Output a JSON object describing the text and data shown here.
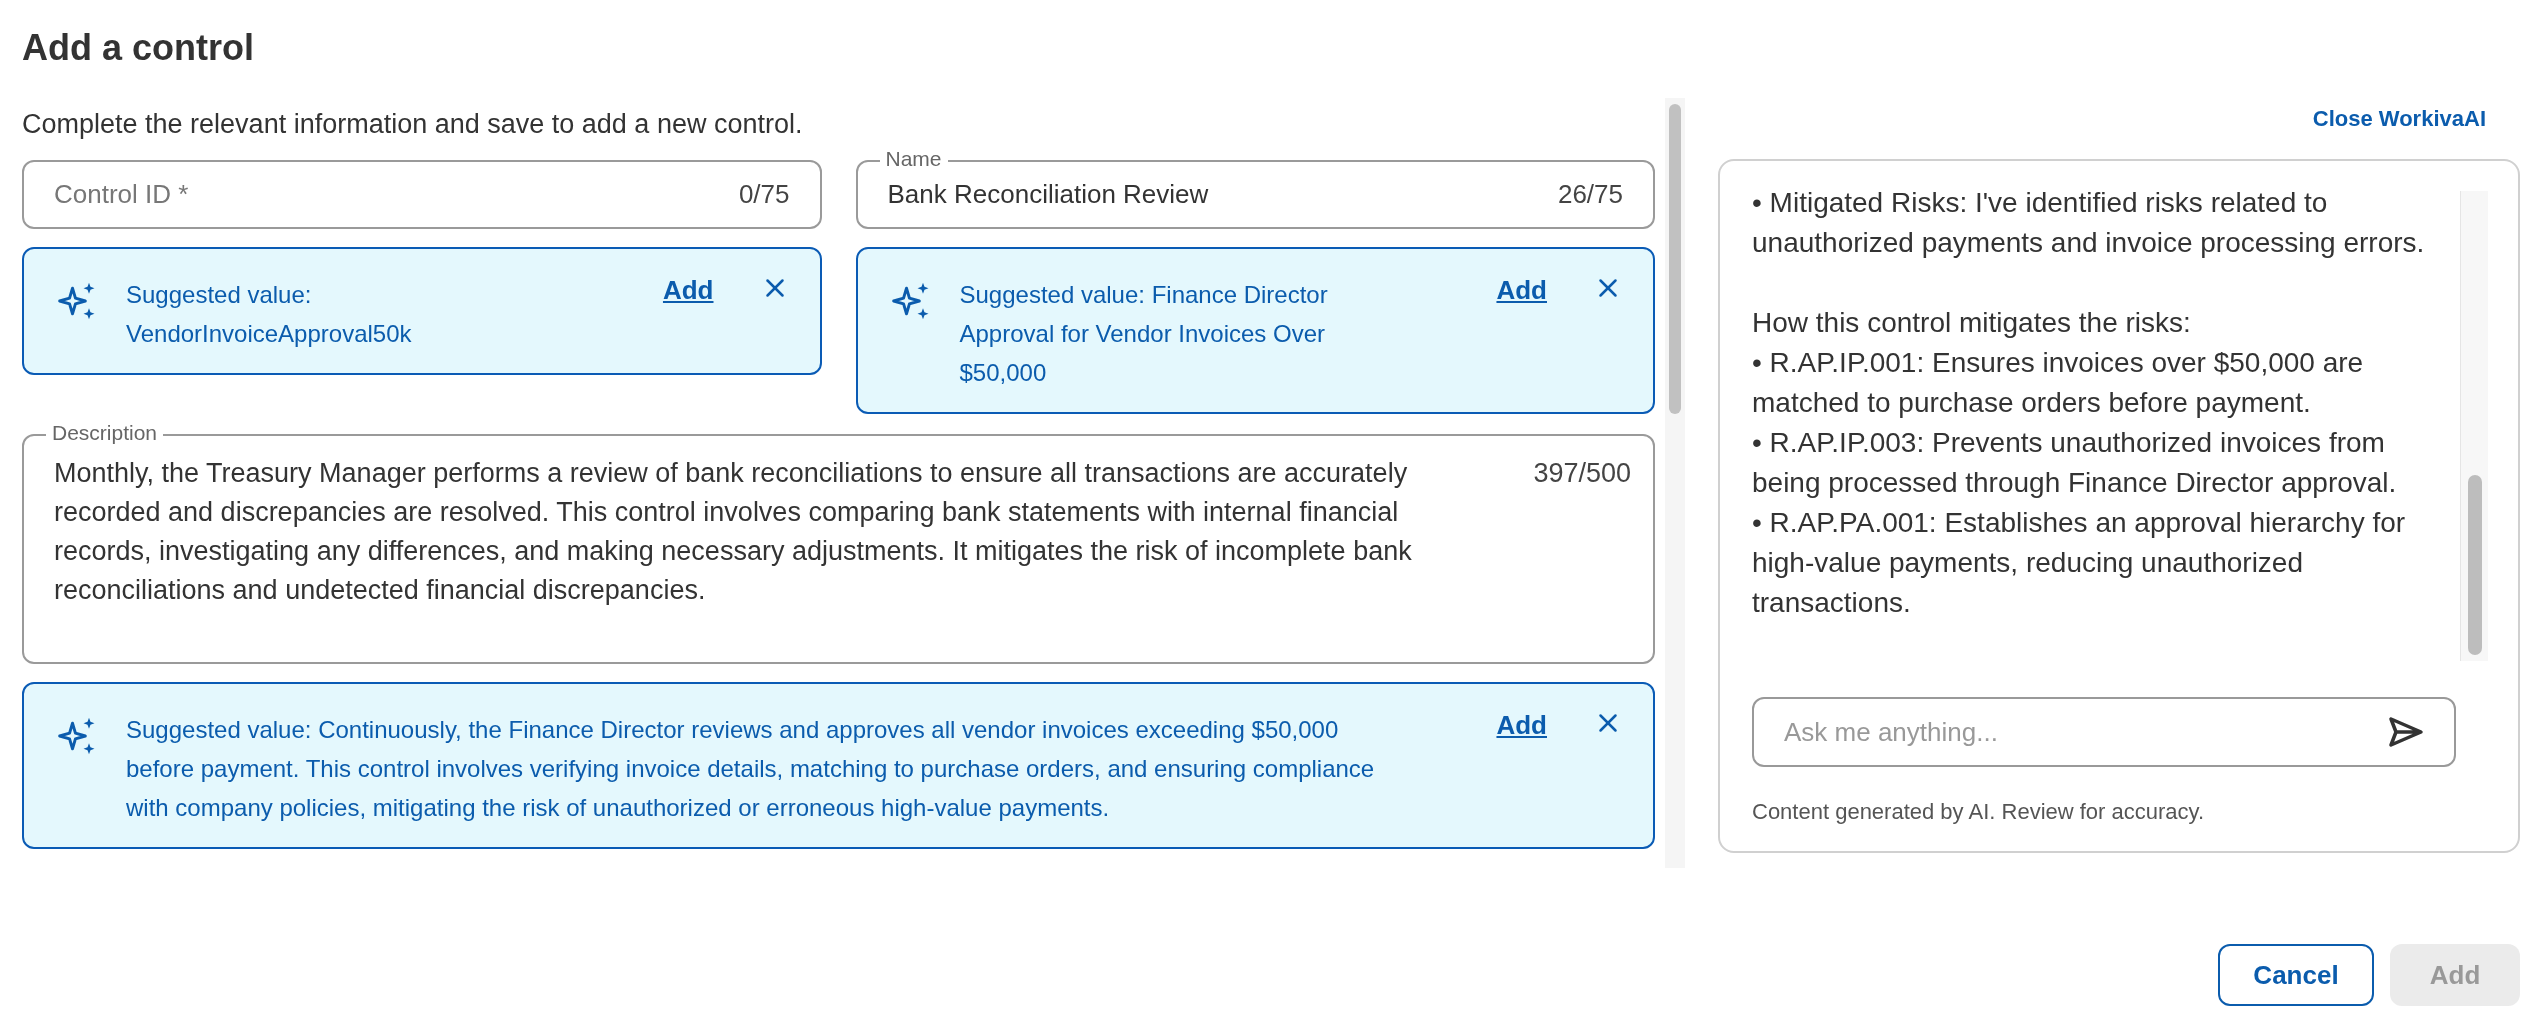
{
  "title": "Add a control",
  "instructions": "Complete the relevant information and save to add a new control.",
  "field_rows": [
    {
      "fields": [
        {
          "placeholder": "Control ID *",
          "counter": "0/75",
          "suggestion": {
            "text": "Suggested value: VendorInvoiceApproval50k",
            "action": "Add"
          }
        },
        {
          "label": "Name",
          "value": "Bank Reconciliation Review",
          "counter": "26/75",
          "suggestion": {
            "text": "Suggested value: Finance Director Approval for Vendor Invoices Over $50,000",
            "action": "Add"
          }
        }
      ]
    }
  ],
  "description": {
    "label": "Description",
    "value": "Monthly, the Treasury Manager performs a review of bank reconciliations to ensure all transactions are accurately recorded and discrepancies are resolved. This control involves comparing bank statements with internal financial records, investigating any differences, and making necessary adjustments. It mitigates the risk of incomplete bank reconciliations and undetected financial discrepancies.",
    "counter": "397/500",
    "suggestion": {
      "text": "Suggested value: Continuously, the Finance Director reviews and approves all vendor invoices exceeding $50,000 before payment. This control involves verifying invoice details, matching to purchase orders, and ensuring compliance with company policies, mitigating the risk of unauthorized or erroneous high-value payments.",
      "action": "Add"
    }
  },
  "assistant": {
    "close_link": "Close WorkivaAI",
    "paragraphs": [
      [
        "• Mitigated Risks: I've identified risks related to unauthorized payments and invoice processing errors."
      ],
      [
        "How this control mitigates the risks:",
        "• R.AP.IP.001: Ensures invoices over $50,000 are matched to purchase orders before payment.",
        "• R.AP.IP.003: Prevents unauthorized invoices from being processed through Finance Director approval.",
        "• R.AP.PA.001: Establishes an approval hierarchy for high-value payments, reducing unauthorized transactions."
      ]
    ],
    "input": {
      "placeholder": "Ask me anything..."
    },
    "disclaimer": "Content generated by AI. Review for accuracy."
  },
  "buttons": [
    {
      "label": "Cancel",
      "kind": "secondary",
      "disabled": false
    },
    {
      "label": "Add",
      "kind": "primary",
      "disabled": true
    }
  ]
}
